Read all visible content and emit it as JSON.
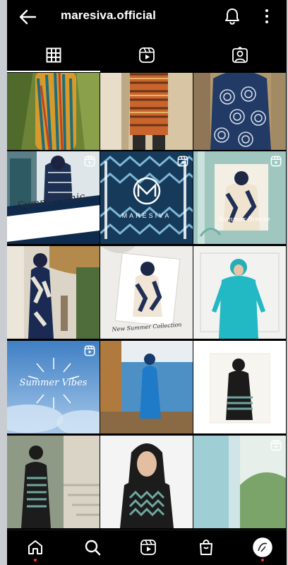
{
  "header": {
    "username": "maresiva.official",
    "back_icon": "arrow-left-icon",
    "bell_icon": "bell-icon",
    "more_icon": "more-vertical-icon"
  },
  "tabs": [
    {
      "name": "posts-grid",
      "icon": "grid-icon",
      "selected": true
    },
    {
      "name": "reels",
      "icon": "reels-icon",
      "selected": false
    },
    {
      "name": "tagged",
      "icon": "tagged-person-icon",
      "selected": false
    }
  ],
  "posts": [
    {
      "caption": "",
      "reel": false
    },
    {
      "caption": "",
      "reel": false
    },
    {
      "caption": "",
      "reel": false
    },
    {
      "caption": "Summer Chic",
      "reel": true
    },
    {
      "caption": "MARESIVA",
      "reel": true
    },
    {
      "caption": "Summer Breeze",
      "reel": true
    },
    {
      "caption": "",
      "reel": false
    },
    {
      "caption": "New Summer Collection",
      "reel": false
    },
    {
      "caption": "",
      "reel": false
    },
    {
      "caption": "Summer Vibes",
      "reel": true
    },
    {
      "caption": "",
      "reel": false
    },
    {
      "caption": "",
      "reel": false
    },
    {
      "caption": "",
      "reel": false
    },
    {
      "caption": "",
      "reel": false
    },
    {
      "caption": "",
      "reel": true
    }
  ],
  "bottom_nav": [
    {
      "name": "home",
      "icon": "home-icon",
      "notification": true
    },
    {
      "name": "search",
      "icon": "search-icon",
      "notification": false
    },
    {
      "name": "reels",
      "icon": "reels-icon",
      "notification": false
    },
    {
      "name": "shop",
      "icon": "shopping-bag-icon",
      "notification": false
    },
    {
      "name": "profile",
      "icon": "profile-avatar-icon",
      "notification": true
    }
  ],
  "colors": {
    "background": "#000000",
    "foreground": "#ffffff",
    "notification_dot": "#ff3040"
  }
}
